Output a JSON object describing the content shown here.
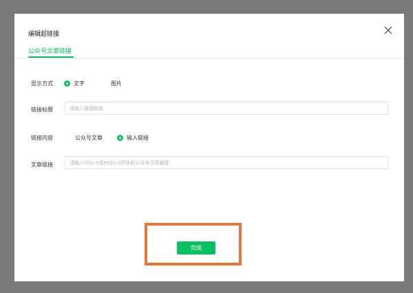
{
  "dialog": {
    "title": "编辑超链接",
    "close_icon": "close-icon",
    "tab": "公众号文章链接",
    "display_mode": {
      "label": "显示方式",
      "options": [
        "文字",
        "图片"
      ],
      "selected": "文字"
    },
    "link_title": {
      "label": "链接标题",
      "placeholder": "请输入链接标题",
      "value": ""
    },
    "link_content": {
      "label": "链接内容",
      "options": [
        "公众号文章",
        "输入链接"
      ],
      "selected": "输入链接"
    },
    "article_link": {
      "label": "文章链接",
      "placeholder": "请输入http://或https://开头的公众号文章链接",
      "value": ""
    },
    "done_button": "完成"
  },
  "colors": {
    "accent": "#07c160",
    "overlay": "#7a7a7a",
    "highlight_box": "#e5773a"
  }
}
